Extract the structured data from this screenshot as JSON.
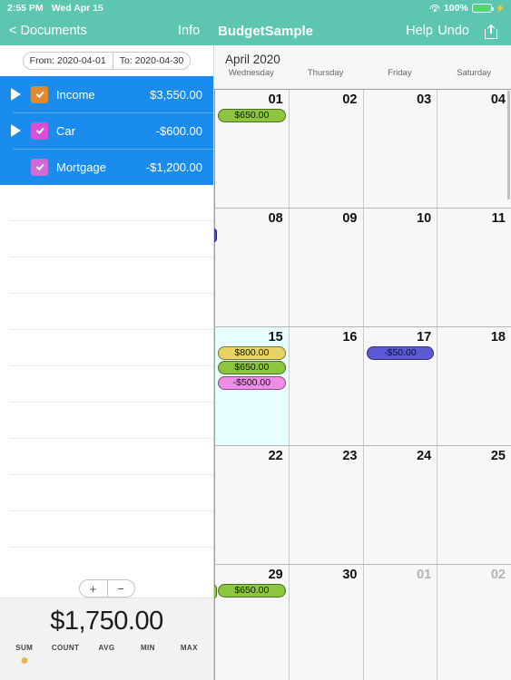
{
  "status_bar": {
    "time": "2:55 PM",
    "date": "Wed Apr 15",
    "battery_percent": "100%",
    "wifi_icon": "wifi-icon",
    "battery_icon": "battery-charging-icon"
  },
  "nav_bar": {
    "back_label": "< Documents",
    "info_label": "Info",
    "document_title": "BudgetSample",
    "help_label": "Help",
    "undo_label": "Undo",
    "share_icon": "share-icon",
    "accent_color": "#5cc6b0"
  },
  "sidebar": {
    "date_range": {
      "from_label": "From: 2020-04-01",
      "to_label": "To: 2020-04-30"
    },
    "selection_color": "#1a8ced",
    "categories": [
      {
        "name": "Income",
        "amount": "$3,550.00",
        "checkbox_color": "#e08a2e",
        "has_disclosure": true,
        "checked": true
      },
      {
        "name": "Car",
        "amount": "-$600.00",
        "checkbox_color": "#d94fd9",
        "has_disclosure": true,
        "checked": true
      },
      {
        "name": "Mortgage",
        "amount": "-$1,200.00",
        "checkbox_color": "#cf6bd6",
        "has_disclosure": false,
        "checked": true
      }
    ],
    "empty_row_count": 10,
    "stepper": {
      "add_label": "+",
      "remove_label": "−"
    },
    "stats": {
      "value": "$1,750.00",
      "tabs": [
        "SUM",
        "COUNT",
        "AVG",
        "MIN",
        "MAX"
      ],
      "selected_index": 0,
      "indicator_color": "#e8b64c"
    }
  },
  "calendar": {
    "month_title": "April 2020",
    "day_headers": [
      "Wednesday",
      "Thursday",
      "Friday",
      "Saturday"
    ],
    "today": "15",
    "weeks": [
      {
        "left_stub": null,
        "days": [
          {
            "num": "01",
            "dim": false,
            "events": [
              {
                "amount": "$650.00",
                "color": "#8cc63f"
              }
            ]
          },
          {
            "num": "02",
            "dim": false,
            "events": []
          },
          {
            "num": "03",
            "dim": false,
            "events": []
          },
          {
            "num": "04",
            "dim": false,
            "events": []
          }
        ]
      },
      {
        "left_stub": {
          "color": "#4a47b5"
        },
        "days": [
          {
            "num": "08",
            "dim": false,
            "events": []
          },
          {
            "num": "09",
            "dim": false,
            "events": []
          },
          {
            "num": "10",
            "dim": false,
            "events": []
          },
          {
            "num": "11",
            "dim": false,
            "events": []
          }
        ]
      },
      {
        "left_stub": null,
        "days": [
          {
            "num": "15",
            "dim": false,
            "today": true,
            "events": [
              {
                "amount": "$800.00",
                "color": "#e8d464"
              },
              {
                "amount": "$650.00",
                "color": "#8cc63f"
              },
              {
                "amount": "-$500.00",
                "color": "#ee8ce8"
              }
            ]
          },
          {
            "num": "16",
            "dim": false,
            "events": []
          },
          {
            "num": "17",
            "dim": false,
            "events": [
              {
                "amount": "-$50.00",
                "color": "#5b59d6"
              }
            ]
          },
          {
            "num": "18",
            "dim": false,
            "events": []
          }
        ]
      },
      {
        "left_stub": null,
        "days": [
          {
            "num": "22",
            "dim": false,
            "events": []
          },
          {
            "num": "23",
            "dim": false,
            "events": []
          },
          {
            "num": "24",
            "dim": false,
            "events": []
          },
          {
            "num": "25",
            "dim": false,
            "events": []
          }
        ]
      },
      {
        "left_stub": {
          "color": "#8cc63f"
        },
        "days": [
          {
            "num": "29",
            "dim": false,
            "events": [
              {
                "amount": "$650.00",
                "color": "#8cc63f"
              }
            ]
          },
          {
            "num": "30",
            "dim": false,
            "events": []
          },
          {
            "num": "01",
            "dim": true,
            "events": []
          },
          {
            "num": "02",
            "dim": true,
            "events": []
          }
        ]
      }
    ]
  }
}
